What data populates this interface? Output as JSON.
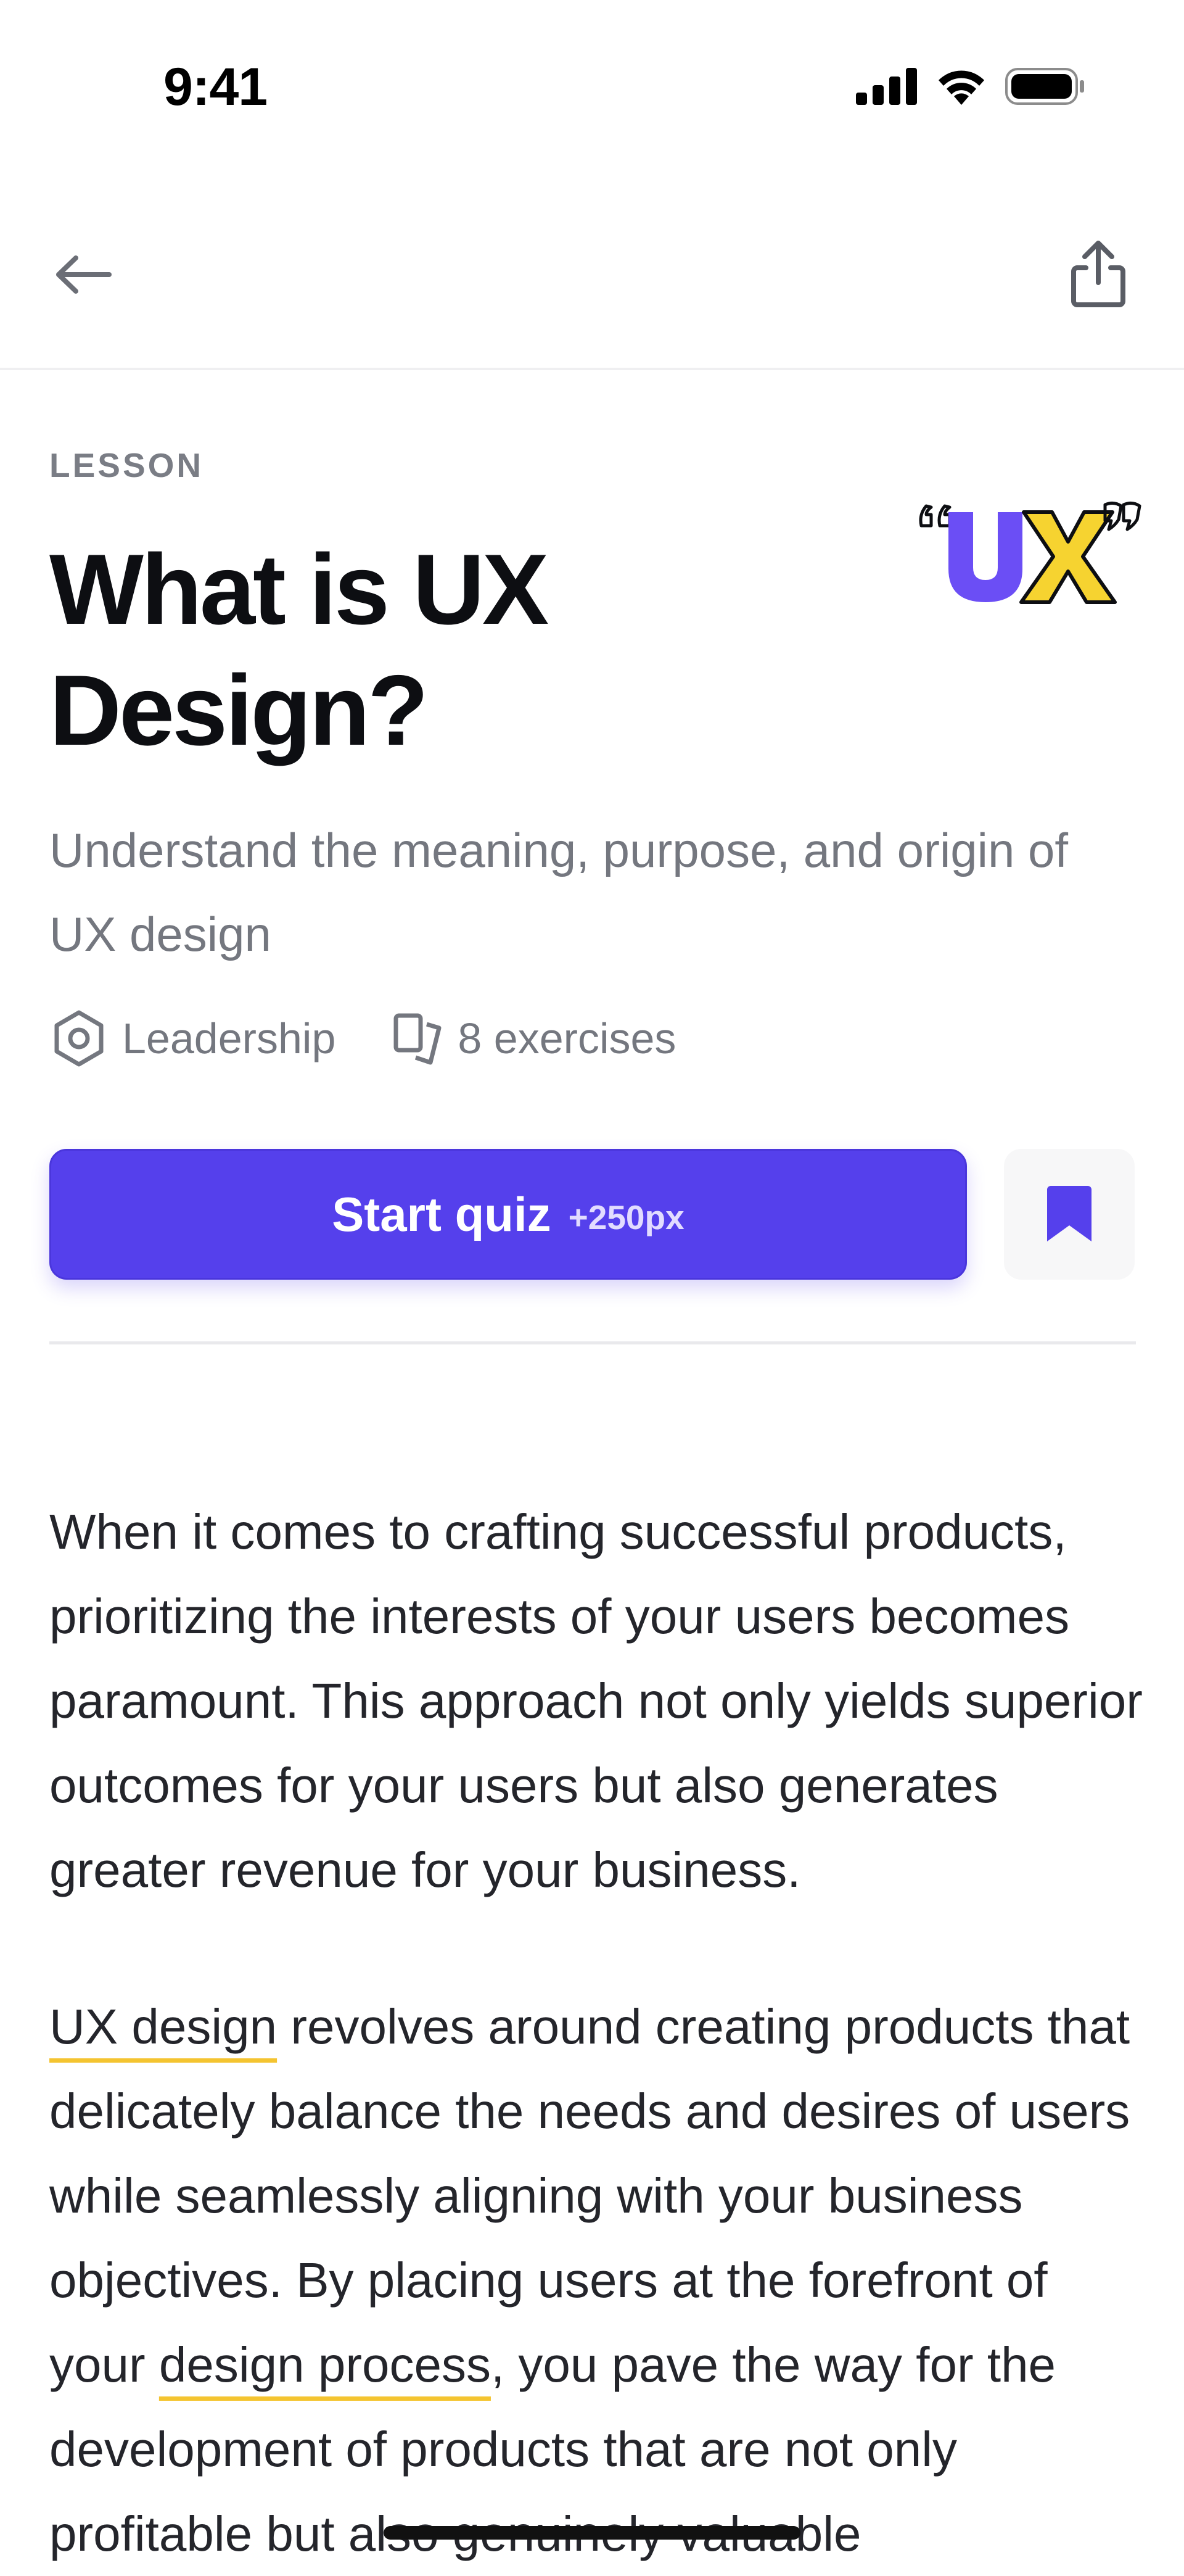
{
  "status_bar": {
    "time": "9:41",
    "icons": [
      "cellular-signal-icon",
      "wifi-icon",
      "battery-icon"
    ]
  },
  "nav": {
    "back_icon": "arrow-left-icon",
    "share_icon": "share-icon"
  },
  "lesson": {
    "eyebrow": "LESSON",
    "title": "What is UX Design?",
    "subtitle": "Understand the meaning, purpose, and origin of UX design",
    "badge": {
      "letters": "UX",
      "colors": {
        "u": "#6b4ef5",
        "x": "#f6d330",
        "outline": "#0d0e12"
      }
    },
    "meta": {
      "category": "Leadership",
      "category_icon": "gear-icon",
      "exercises": "8 exercises",
      "exercises_icon": "cards-icon"
    }
  },
  "actions": {
    "start_label": "Start quiz",
    "points": "+250px",
    "bookmark_icon": "bookmark-icon"
  },
  "body": {
    "p1": "When it comes to crafting successful products, prioritizing the interests of your users becomes paramount. This approach not only yields superior outcomes for your users but also generates greater revenue for your business.",
    "p2": {
      "term1": "UX design",
      "part1": " revolves around creating products that delicately balance the needs and desires of users while seamlessly aligning with your business objectives. By placing users at the forefront of your ",
      "term2": "design process",
      "part2": ", you pave the way for the development of products that are not only profitable but also genuinely valuable"
    }
  },
  "colors": {
    "primary": "#5540ec",
    "highlight_underline": "#f4c430",
    "muted_text": "#74777f"
  }
}
